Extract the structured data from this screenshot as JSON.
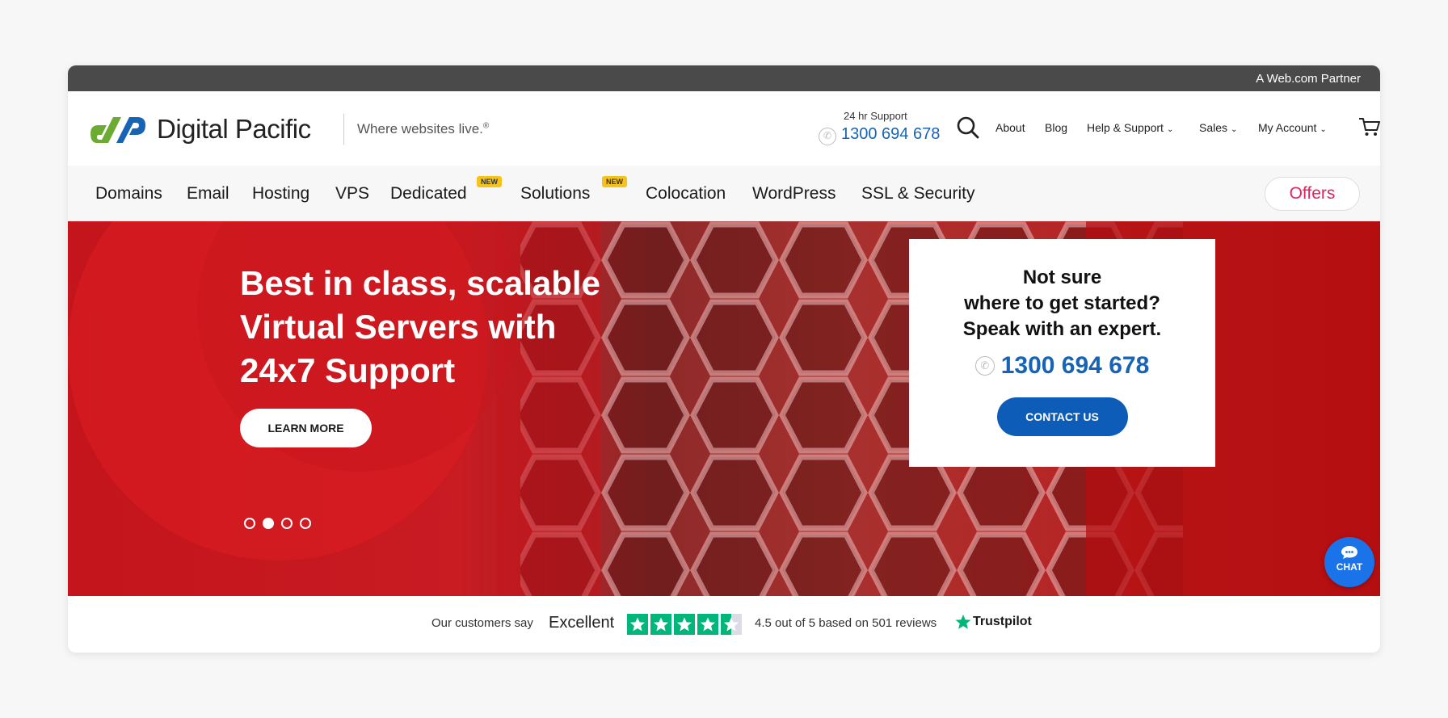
{
  "partner_bar": {
    "text": "A Web.com Partner"
  },
  "header": {
    "brand": "Digital Pacific",
    "tagline": "Where websites live.",
    "tagline_mark": "®",
    "support_label": "24 hr Support",
    "support_phone": "1300 694 678",
    "links": [
      {
        "label": "About",
        "has_menu": false
      },
      {
        "label": "Blog",
        "has_menu": false
      },
      {
        "label": "Help & Support",
        "has_menu": true
      },
      {
        "label": "Sales",
        "has_menu": true
      },
      {
        "label": "My Account",
        "has_menu": true
      }
    ],
    "chevron": "⌄",
    "icons": [
      "search-icon",
      "cart-icon",
      "phone-icon"
    ]
  },
  "nav": {
    "items": [
      {
        "label": "Domains"
      },
      {
        "label": "Email"
      },
      {
        "label": "Hosting"
      },
      {
        "label": "VPS"
      },
      {
        "label": "Dedicated",
        "badge": "NEW"
      },
      {
        "label": "Solutions",
        "badge": "NEW"
      },
      {
        "label": "Colocation"
      },
      {
        "label": "WordPress"
      },
      {
        "label": "SSL & Security"
      }
    ],
    "offers_label": "Offers"
  },
  "hero": {
    "title_lines": [
      "Best in class, scalable",
      "Virtual Servers with",
      "24x7 Support"
    ],
    "cta_label": "LEARN MORE",
    "slides": 4,
    "active_slide": 2,
    "card": {
      "lines": [
        "Not sure",
        "where to get started?",
        "Speak with an expert."
      ],
      "phone": "1300 694 678",
      "cta_label": "CONTACT US"
    },
    "chat_label": "CHAT"
  },
  "trust": {
    "say": "Our customers say",
    "verdict": "Excellent",
    "rating": 4.5,
    "summary": "4.5 out of 5 based on 501 reviews",
    "brand": "Trustpilot"
  },
  "colors": {
    "brand_blue": "#1764b5",
    "hero_red": "#c4141c",
    "offers_pink": "#e0245e",
    "badge_yellow": "#f6c31b",
    "trust_green": "#00b67a"
  }
}
